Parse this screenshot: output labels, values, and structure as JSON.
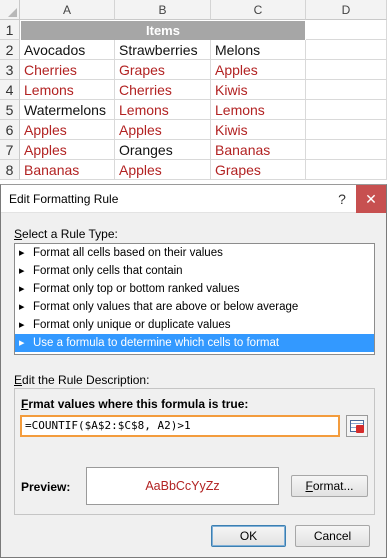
{
  "sheet": {
    "columns": [
      "A",
      "B",
      "C",
      "D"
    ],
    "row_numbers": [
      "1",
      "2",
      "3",
      "4",
      "5",
      "6",
      "7",
      "8"
    ],
    "header_title": "Items",
    "rows": [
      [
        {
          "text": "Avocados",
          "red": false
        },
        {
          "text": "Strawberries",
          "red": false
        },
        {
          "text": "Melons",
          "red": false
        }
      ],
      [
        {
          "text": "Cherries",
          "red": true
        },
        {
          "text": "Grapes",
          "red": true
        },
        {
          "text": "Apples",
          "red": true
        }
      ],
      [
        {
          "text": "Lemons",
          "red": true
        },
        {
          "text": "Cherries",
          "red": true
        },
        {
          "text": "Kiwis",
          "red": true
        }
      ],
      [
        {
          "text": "Watermelons",
          "red": false
        },
        {
          "text": "Lemons",
          "red": true
        },
        {
          "text": "Lemons",
          "red": true
        }
      ],
      [
        {
          "text": "Apples",
          "red": true
        },
        {
          "text": "Apples",
          "red": true
        },
        {
          "text": "Kiwis",
          "red": true
        }
      ],
      [
        {
          "text": "Apples",
          "red": true
        },
        {
          "text": "Oranges",
          "red": false
        },
        {
          "text": "Bananas",
          "red": true
        }
      ],
      [
        {
          "text": "Bananas",
          "red": true
        },
        {
          "text": "Apples",
          "red": true
        },
        {
          "text": "Grapes",
          "red": true
        }
      ]
    ],
    "highlight_color": "#b22222"
  },
  "dialog": {
    "title": "Edit Formatting Rule",
    "help_label": "?",
    "close_label": "✕",
    "rule_type_label_prefix": "S",
    "rule_type_label_rest": "elect a Rule Type:",
    "rule_types": [
      {
        "label": "Format all cells based on their values",
        "selected": false
      },
      {
        "label": "Format only cells that contain",
        "selected": false
      },
      {
        "label": "Format only top or bottom ranked values",
        "selected": false
      },
      {
        "label": "Format only values that are above or below average",
        "selected": false
      },
      {
        "label": "Format only unique or duplicate values",
        "selected": false
      },
      {
        "label": "Use a formula to determine which cells to format",
        "selected": true
      }
    ],
    "description_label_prefix": "E",
    "description_label_rest": "dit the Rule Description:",
    "formula_label_prefix": "O",
    "formula_label_before": "F",
    "formula_label_rest": "rmat values where this formula is true:",
    "formula_value": "=COUNTIF($A$2:$C$8, A2)>1",
    "preview_label": "Preview:",
    "preview_sample": "AaBbCcYyZz",
    "format_button": "Format...",
    "format_button_underline": "F",
    "ok_button": "OK",
    "cancel_button": "Cancel",
    "selection_color": "#3399ff",
    "formula_border_color": "#f39c3d"
  }
}
